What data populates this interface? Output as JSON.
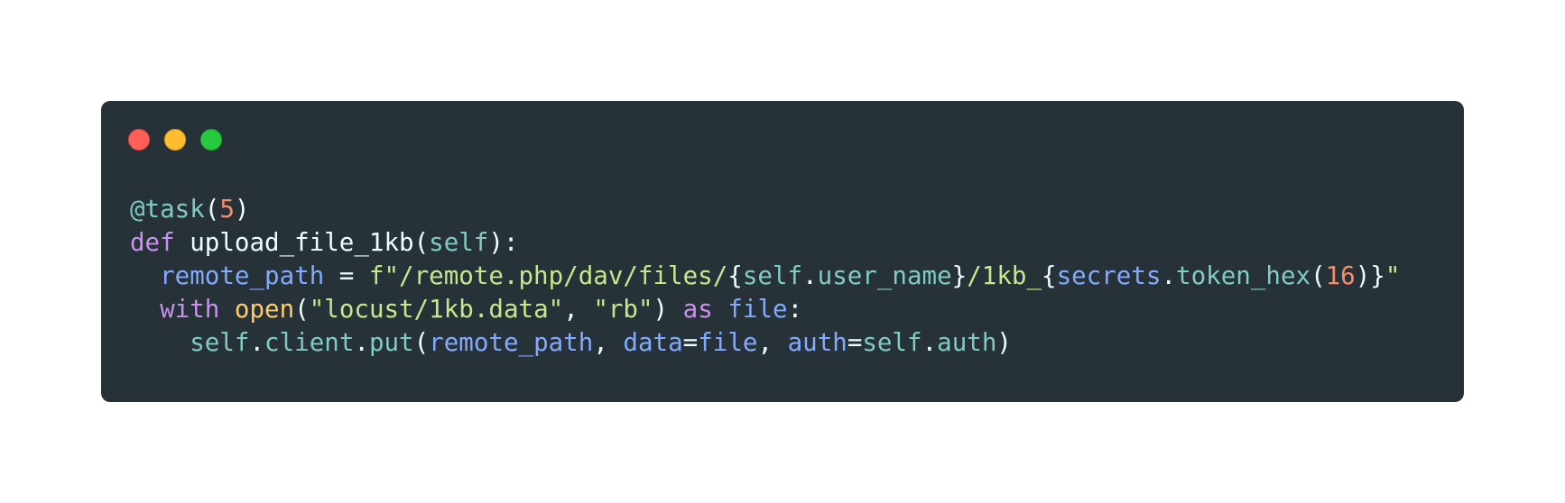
{
  "window": {
    "background": "#263238",
    "controls": [
      {
        "name": "close",
        "color": "#ff5f56"
      },
      {
        "name": "minimize",
        "color": "#ffbd2e"
      },
      {
        "name": "maximize",
        "color": "#27c93f"
      }
    ]
  },
  "code": {
    "language": "python",
    "lines": [
      {
        "indent": "",
        "tokens": [
          {
            "t": "@task",
            "k": "deco"
          },
          {
            "t": "(",
            "k": "punc"
          },
          {
            "t": "5",
            "k": "num"
          },
          {
            "t": ")",
            "k": "punc"
          }
        ]
      },
      {
        "indent": "",
        "tokens": [
          {
            "t": "def",
            "k": "kw"
          },
          {
            "t": " upload_file_1kb(",
            "k": "plain"
          },
          {
            "t": "self",
            "k": "self"
          },
          {
            "t": "):",
            "k": "punc"
          }
        ]
      },
      {
        "indent": "  ",
        "tokens": [
          {
            "t": "remote_path",
            "k": "var"
          },
          {
            "t": " = ",
            "k": "punc"
          },
          {
            "t": "f\"/remote.php/dav/files/",
            "k": "str"
          },
          {
            "t": "{",
            "k": "punc"
          },
          {
            "t": "self",
            "k": "self"
          },
          {
            "t": ".",
            "k": "punc"
          },
          {
            "t": "user_name",
            "k": "attr"
          },
          {
            "t": "}",
            "k": "punc"
          },
          {
            "t": "/1kb_",
            "k": "str"
          },
          {
            "t": "{",
            "k": "punc"
          },
          {
            "t": "secrets",
            "k": "var"
          },
          {
            "t": ".",
            "k": "punc"
          },
          {
            "t": "token_hex",
            "k": "attr"
          },
          {
            "t": "(",
            "k": "punc"
          },
          {
            "t": "16",
            "k": "num"
          },
          {
            "t": ")}",
            "k": "punc"
          },
          {
            "t": "\"",
            "k": "str"
          }
        ]
      },
      {
        "indent": "  ",
        "tokens": [
          {
            "t": "with",
            "k": "kw"
          },
          {
            "t": " ",
            "k": "punc"
          },
          {
            "t": "open",
            "k": "func"
          },
          {
            "t": "(",
            "k": "punc"
          },
          {
            "t": "\"locust/1kb.data\"",
            "k": "str"
          },
          {
            "t": ", ",
            "k": "punc"
          },
          {
            "t": "\"rb\"",
            "k": "str"
          },
          {
            "t": ") ",
            "k": "punc"
          },
          {
            "t": "as",
            "k": "kw"
          },
          {
            "t": " ",
            "k": "punc"
          },
          {
            "t": "file",
            "k": "var"
          },
          {
            "t": ":",
            "k": "punc"
          }
        ]
      },
      {
        "indent": "    ",
        "tokens": [
          {
            "t": "self",
            "k": "self"
          },
          {
            "t": ".",
            "k": "punc"
          },
          {
            "t": "client",
            "k": "attr"
          },
          {
            "t": ".",
            "k": "punc"
          },
          {
            "t": "put",
            "k": "attr"
          },
          {
            "t": "(",
            "k": "punc"
          },
          {
            "t": "remote_path",
            "k": "var"
          },
          {
            "t": ", ",
            "k": "punc"
          },
          {
            "t": "data",
            "k": "var"
          },
          {
            "t": "=",
            "k": "punc"
          },
          {
            "t": "file",
            "k": "var"
          },
          {
            "t": ", ",
            "k": "punc"
          },
          {
            "t": "auth",
            "k": "var"
          },
          {
            "t": "=",
            "k": "punc"
          },
          {
            "t": "self",
            "k": "self"
          },
          {
            "t": ".",
            "k": "punc"
          },
          {
            "t": "auth",
            "k": "attr"
          },
          {
            "t": ")",
            "k": "punc"
          }
        ]
      }
    ]
  }
}
